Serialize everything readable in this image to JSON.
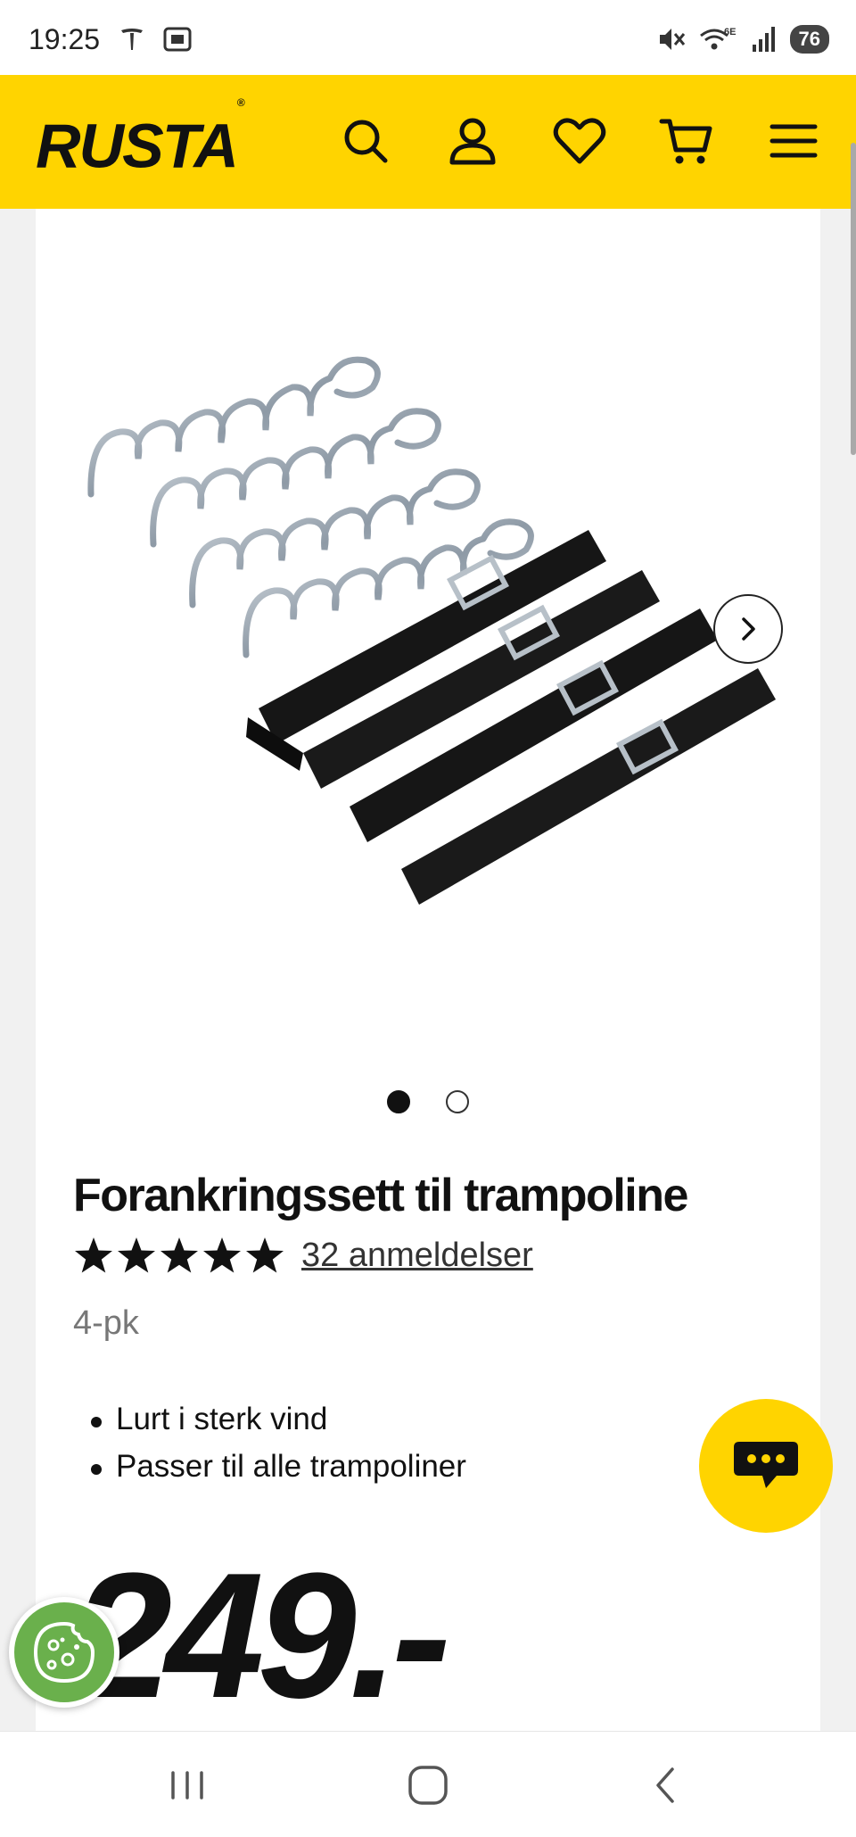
{
  "status_bar": {
    "time": "19:25",
    "battery": "76",
    "icons": [
      "tesla-icon",
      "screenshot-icon",
      "mute-icon",
      "wifi-6e-icon",
      "signal-icon"
    ]
  },
  "header": {
    "logo": "RUSTA",
    "icons": [
      "search-icon",
      "account-icon",
      "favorites-icon",
      "cart-icon",
      "menu-icon"
    ],
    "brand_color": "#ffd400"
  },
  "gallery": {
    "image_description_name": "anchor-kit-image",
    "total_images": 2,
    "active_index": 0
  },
  "product": {
    "title": "Forankringssett til trampoline",
    "rating": 5,
    "reviews_label": "32 anmeldelser",
    "variant": "4-pk",
    "bullets": [
      "Lurt i sterk vind",
      "Passer til alle trampoliner"
    ],
    "price": "249.-"
  },
  "floating": {
    "chat": "chat-icon",
    "cookie": "cookie-icon"
  },
  "navbar": {
    "items": [
      "recent-apps-icon",
      "home-icon",
      "back-icon"
    ]
  }
}
